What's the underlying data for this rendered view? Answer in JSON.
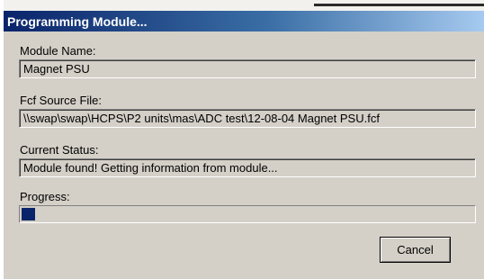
{
  "dialog": {
    "title": "Programming Module..."
  },
  "module_name": {
    "label": "Module Name:",
    "value": "Magnet PSU"
  },
  "source_file": {
    "label": "Fcf Source File:",
    "value": "\\\\swap\\swap\\HCPS\\P2 units\\mas\\ADC test\\12-08-04 Magnet PSU.fcf"
  },
  "current_status": {
    "label": "Current Status:",
    "value": "Module found!  Getting information from module..."
  },
  "progress": {
    "label": "Progress:",
    "fraction": 0.03,
    "fill_color": "#0a246a"
  },
  "buttons": {
    "cancel": "Cancel"
  },
  "colors": {
    "title_bar_start": "#0a246a",
    "title_bar_end": "#a6caf0",
    "dialog_face": "#d4d0c8"
  }
}
